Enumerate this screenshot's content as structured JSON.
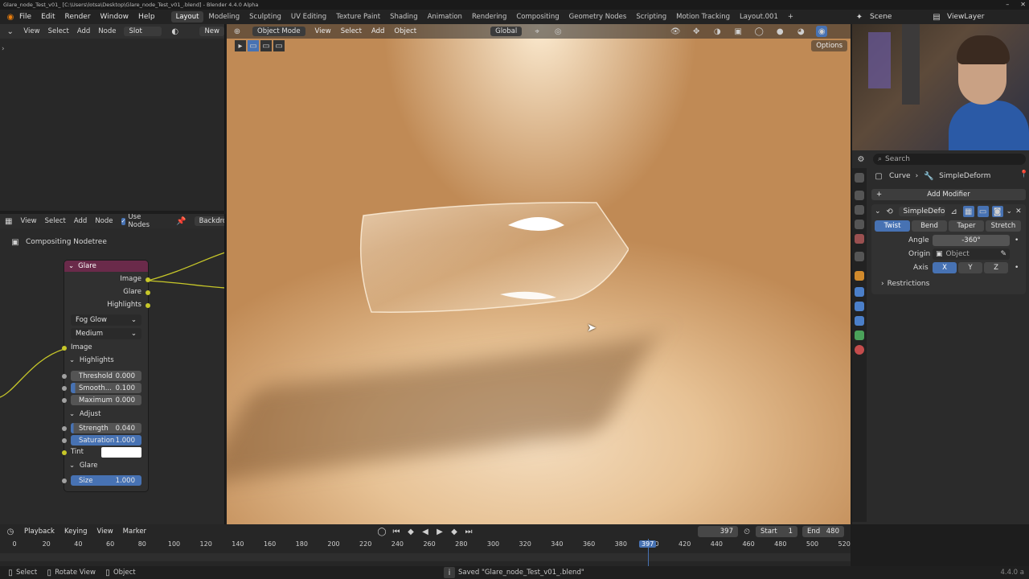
{
  "window": {
    "title": "Glare_node_Test_v01_ [C:\\Users\\lotsa\\Desktop\\Glare_node_Test_v01_.blend] - Blender 4.4.0 Alpha"
  },
  "menu": {
    "items": [
      "File",
      "Edit",
      "Render",
      "Window",
      "Help"
    ],
    "workspaces": [
      "Layout",
      "Modeling",
      "Sculpting",
      "UV Editing",
      "Texture Paint",
      "Shading",
      "Animation",
      "Rendering",
      "Compositing",
      "Geometry Nodes",
      "Scripting",
      "Motion Tracking",
      "Layout.001"
    ],
    "active_workspace": "Layout",
    "scene": "Scene",
    "view_layer": "ViewLayer"
  },
  "left_top": {
    "menus": [
      "View",
      "Select",
      "Add",
      "Node"
    ],
    "slot": "Slot",
    "new": "New"
  },
  "node_editor": {
    "menus": [
      "View",
      "Select",
      "Add",
      "Node"
    ],
    "use_nodes": "Use Nodes",
    "backdrop": "Backdro",
    "breadcrumb": "Compositing Nodetree",
    "node": {
      "title": "Glare",
      "outputs": [
        "Image",
        "Glare",
        "Highlights"
      ],
      "type_dropdown": "Fog Glow",
      "quality_dropdown": "Medium",
      "input_image": "Image",
      "highlights_panel": "Highlights",
      "threshold_label": "Threshold",
      "threshold_value": "0.000",
      "smooth_label": "Smooth...",
      "smooth_value": "0.100",
      "maximum_label": "Maximum",
      "maximum_value": "0.000",
      "adjust_panel": "Adjust",
      "strength_label": "Strength",
      "strength_value": "0.040",
      "saturation_label": "Saturation",
      "saturation_value": "1.000",
      "tint_label": "Tint",
      "glare_panel": "Glare",
      "size_label": "Size",
      "size_value": "1.000"
    }
  },
  "viewport": {
    "mode": "Object Mode",
    "menus": [
      "View",
      "Select",
      "Add",
      "Object"
    ],
    "transform": "Global",
    "options": "Options"
  },
  "properties": {
    "search_placeholder": "Search",
    "breadcrumb_object": "Curve",
    "breadcrumb_modifier": "SimpleDeform",
    "add_modifier": "Add Modifier",
    "modifier_name": "SimpleDefo...",
    "modes": [
      "Twist",
      "Bend",
      "Taper",
      "Stretch"
    ],
    "active_mode": "Twist",
    "angle_label": "Angle",
    "angle_value": "-360°",
    "origin_label": "Origin",
    "origin_placeholder": "Object",
    "axis_label": "Axis",
    "axes": [
      "X",
      "Y",
      "Z"
    ],
    "restrictions": "Restrictions"
  },
  "timeline": {
    "menus": [
      "Playback",
      "Keying",
      "View",
      "Marker"
    ],
    "current_frame": "397",
    "start_label": "Start",
    "start_value": "1",
    "end_label": "End",
    "end_value": "480",
    "ruler_labels": [
      "0",
      "20",
      "40",
      "60",
      "80",
      "100",
      "120",
      "140",
      "160",
      "180",
      "200",
      "220",
      "240",
      "260",
      "280",
      "300",
      "320",
      "340",
      "360",
      "380",
      "400",
      "420",
      "440",
      "460",
      "480",
      "500",
      "520"
    ]
  },
  "status": {
    "select": "Select",
    "rotate_view": "Rotate View",
    "object": "Object",
    "saved_message": "Saved \"Glare_node_Test_v01_.blend\"",
    "version": "4.4.0 a"
  }
}
